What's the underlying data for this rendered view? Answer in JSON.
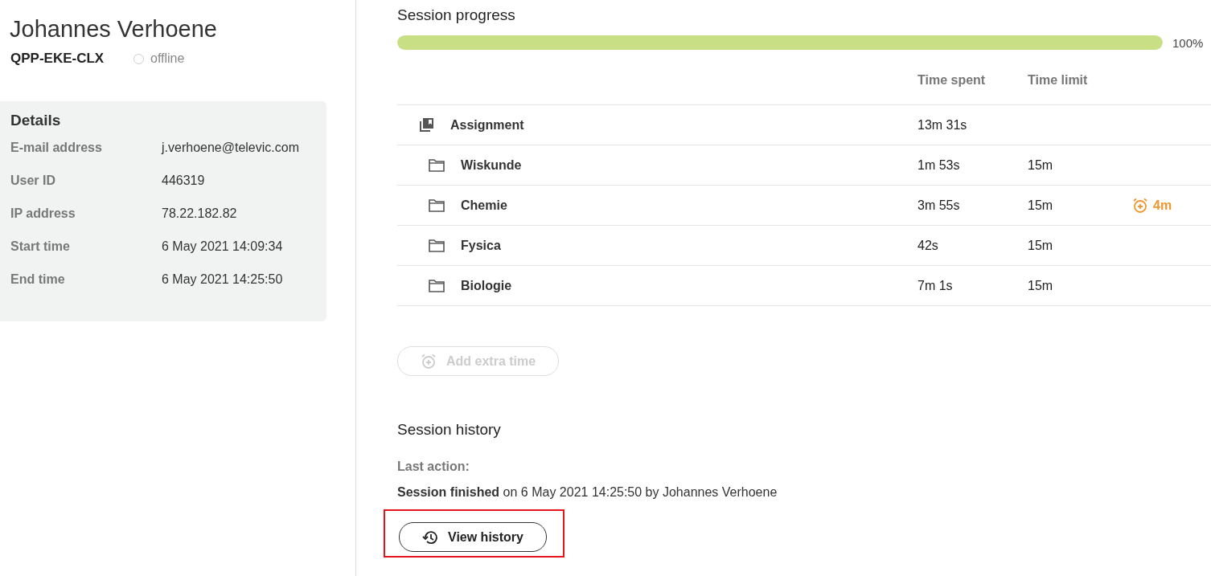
{
  "user": {
    "name": "Johannes Verhoene",
    "code": "QPP-EKE-CLX",
    "online": false,
    "status": "offline"
  },
  "details": {
    "title": "Details",
    "fields": [
      {
        "label": "E-mail address",
        "value": "j.verhoene@televic.com"
      },
      {
        "label": "User ID",
        "value": "446319"
      },
      {
        "label": "IP address",
        "value": "78.22.182.82"
      },
      {
        "label": "Start time",
        "value": "6 May 2021 14:09:34"
      },
      {
        "label": "End time",
        "value": "6 May 2021 14:25:50"
      }
    ]
  },
  "progress": {
    "title": "Session progress",
    "level": 1,
    "reading": "100%"
  },
  "table": {
    "columns": [
      "Time spent",
      "Time limit"
    ],
    "rows": [
      {
        "kind": "assignment",
        "name": "Assignment",
        "time_spent": "13m 31s",
        "children": [
          {
            "kind": "folder",
            "name": "Wiskunde",
            "time_spent": "1m 53s",
            "time_limit": "15m"
          },
          {
            "kind": "folder",
            "name": "Chemie",
            "time_spent": "3m 55s",
            "time_limit": "15m",
            "extra_time": "4m"
          },
          {
            "kind": "folder",
            "name": "Fysica",
            "time_spent": "42s",
            "time_limit": "15m"
          },
          {
            "kind": "folder",
            "name": "Biologie",
            "time_spent": "7m 1s",
            "time_limit": "15m"
          }
        ]
      }
    ]
  },
  "add_extra_time": {
    "label": "Add extra time",
    "disabled": true
  },
  "history": {
    "title": "Session history",
    "last_action_label": "Last action:",
    "last_action": "**Session finished** on 6 May 2021 14:25:50 by Johannes Verhoene",
    "button": {
      "label": "View history",
      "highlighted": true
    }
  }
}
